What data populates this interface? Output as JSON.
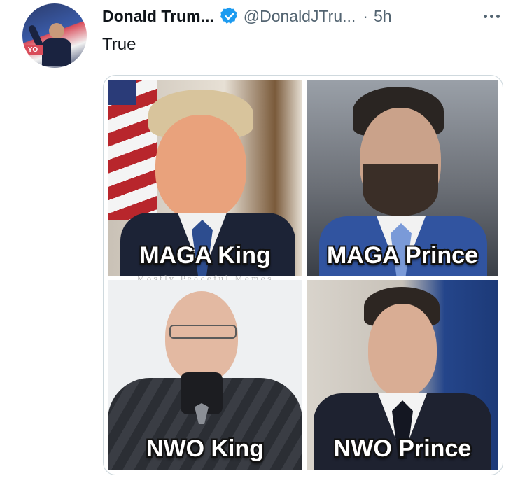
{
  "tweet": {
    "author_name": "Donald Trum...",
    "handle": "@DonaldJTru...",
    "separator": "·",
    "time": "5h",
    "text": "True",
    "avatar_banner": "YO",
    "more_icon": "more-horizontal-icon",
    "verified_icon": "verified-badge-icon",
    "accent_color": "#1d9bf0"
  },
  "meme": {
    "panels": [
      {
        "label": "MAGA King"
      },
      {
        "label": "MAGA Prince"
      },
      {
        "label": "NWO King"
      },
      {
        "label": "NWO Prince"
      }
    ],
    "watermark": "Mostly Peaceful Memes"
  }
}
